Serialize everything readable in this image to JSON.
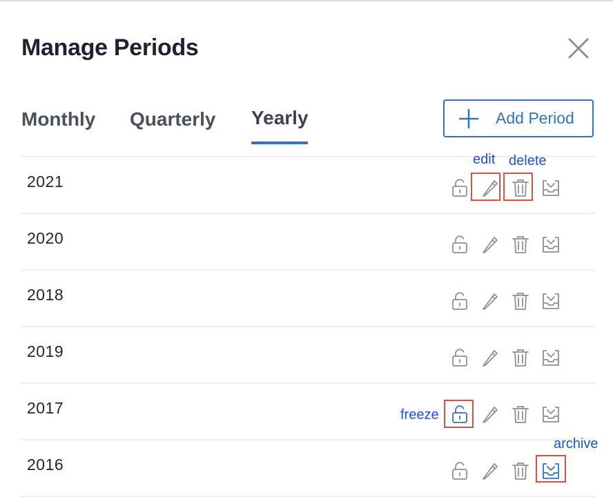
{
  "dialog": {
    "title": "Manage Periods",
    "close_icon": "close-icon"
  },
  "tabs": [
    {
      "label": "Monthly",
      "active": false
    },
    {
      "label": "Quarterly",
      "active": false
    },
    {
      "label": "Yearly",
      "active": true
    }
  ],
  "add_button": {
    "label": "Add Period",
    "icon": "plus-icon"
  },
  "periods": [
    {
      "year": "2021"
    },
    {
      "year": "2020"
    },
    {
      "year": "2018"
    },
    {
      "year": "2019"
    },
    {
      "year": "2017"
    },
    {
      "year": "2016"
    }
  ],
  "row_actions": [
    {
      "name": "freeze",
      "icon": "lock-open-icon"
    },
    {
      "name": "edit",
      "icon": "pencil-icon"
    },
    {
      "name": "delete",
      "icon": "trash-icon"
    },
    {
      "name": "archive",
      "icon": "archive-icon"
    }
  ],
  "annotations": {
    "edit": "edit",
    "delete": "delete",
    "freeze": "freeze",
    "archive": "archive"
  },
  "colors": {
    "accent": "#2f72c8",
    "icon_gray": "#8a8f98",
    "highlight_box": "#d9533a",
    "annotation_text": "#1f4fe0"
  }
}
